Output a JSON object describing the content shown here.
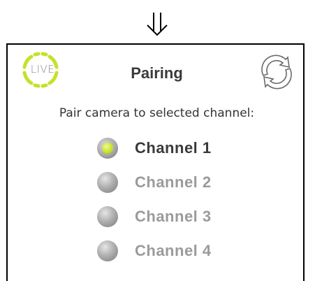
{
  "header": {
    "title": "Pairing",
    "logo_text": "LIVE",
    "logo_accent_color": "#c7e02a"
  },
  "instruction": "Pair camera to selected channel:",
  "channels": [
    {
      "label": "Channel 1",
      "selected": true
    },
    {
      "label": "Channel 2",
      "selected": false
    },
    {
      "label": "Channel 3",
      "selected": false
    },
    {
      "label": "Channel 4",
      "selected": false
    }
  ],
  "icons": {
    "top_arrow": "double-down-arrow-icon",
    "sync": "sync-icon"
  }
}
